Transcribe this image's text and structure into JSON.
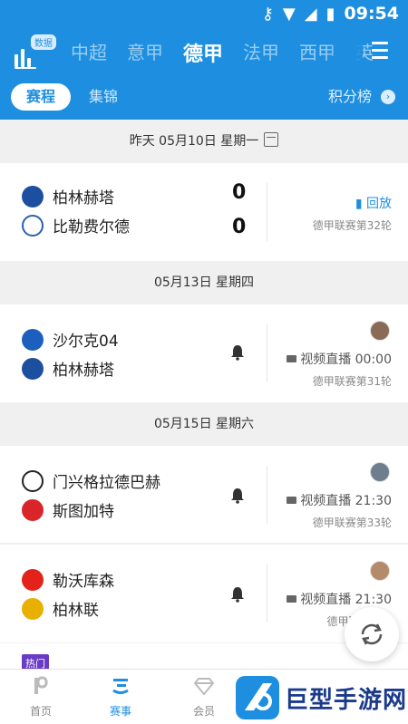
{
  "status": {
    "time": "09:54"
  },
  "header": {
    "data_badge": "数据",
    "leagues": [
      "中超",
      "意甲",
      "德甲",
      "法甲",
      "西甲",
      "英"
    ],
    "active_league_index": 2,
    "subtabs": {
      "active": "赛程",
      "other": "集锦",
      "ranking": "积分榜"
    }
  },
  "sections": [
    {
      "date": "昨天 05月10日 星期一",
      "matches": [
        {
          "home": "柏林赫塔",
          "away": "比勒费尔德",
          "home_score": "0",
          "away_score": "0",
          "action": "回放",
          "round": "德甲联赛第32轮"
        }
      ]
    },
    {
      "date": "05月13日 星期四",
      "matches": [
        {
          "home": "沙尔克04",
          "away": "柏林赫塔",
          "action": "视频直播 00:00",
          "round": "德甲联赛第31轮"
        }
      ]
    },
    {
      "date": "05月15日 星期六",
      "matches": [
        {
          "home": "门兴格拉德巴赫",
          "away": "斯图加特",
          "action": "视频直播 21:30",
          "round": "德甲联赛第33轮"
        },
        {
          "home": "勒沃库森",
          "away": "柏林联",
          "action": "视频直播 21:30",
          "round": "德甲联赛第..."
        }
      ]
    }
  ],
  "hot_badge": "热门",
  "bottom_nav": [
    "首页",
    "赛事",
    "会员"
  ],
  "watermark": "巨型手游网",
  "colors": {
    "brand": "#1e8fe0",
    "hot": "#6a3cc6"
  }
}
